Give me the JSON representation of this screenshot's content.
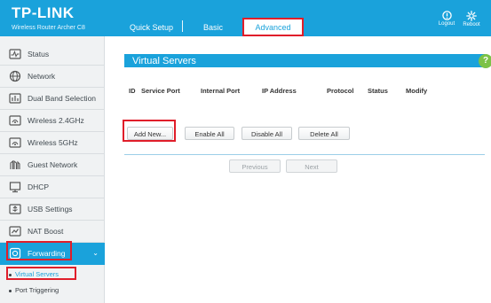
{
  "brand": {
    "logo": "TP-LINK",
    "model": "Wireless Router Archer C8"
  },
  "topnav": {
    "tabs": [
      {
        "label": "Quick Setup"
      },
      {
        "label": "Basic"
      },
      {
        "label": "Advanced",
        "selected": true
      }
    ]
  },
  "header_actions": [
    {
      "label": "Logout",
      "icon": "logout-icon"
    },
    {
      "label": "Reboot",
      "icon": "reboot-icon"
    }
  ],
  "sidebar": {
    "items": [
      {
        "label": "Status",
        "icon": "status-icon"
      },
      {
        "label": "Network",
        "icon": "globe-icon"
      },
      {
        "label": "Dual Band Selection",
        "icon": "dual-band-icon"
      },
      {
        "label": "Wireless 2.4GHz",
        "icon": "wireless-icon"
      },
      {
        "label": "Wireless 5GHz",
        "icon": "wireless-icon"
      },
      {
        "label": "Guest Network",
        "icon": "guest-network-icon"
      },
      {
        "label": "DHCP",
        "icon": "dhcp-icon"
      },
      {
        "label": "USB Settings",
        "icon": "usb-icon"
      },
      {
        "label": "NAT Boost",
        "icon": "nat-boost-icon"
      },
      {
        "label": "Forwarding",
        "icon": "forwarding-icon",
        "active": true
      }
    ],
    "subitems": [
      {
        "label": "Virtual Servers",
        "selected": true
      },
      {
        "label": "Port Triggering"
      }
    ]
  },
  "main": {
    "section_title": "Virtual Servers",
    "help_glyph": "?",
    "table_headers": [
      "ID",
      "Service Port",
      "Internal Port",
      "IP Address",
      "Protocol",
      "Status",
      "Modify"
    ],
    "buttons": {
      "add_new": "Add New...",
      "enable_all": "Enable All",
      "disable_all": "Disable All",
      "delete_all": "Delete All"
    },
    "pagination": {
      "previous": "Previous",
      "next": "Next"
    }
  },
  "colors": {
    "accent": "#1aa2db",
    "highlight": "#e01e2a",
    "help": "#7cc247"
  }
}
